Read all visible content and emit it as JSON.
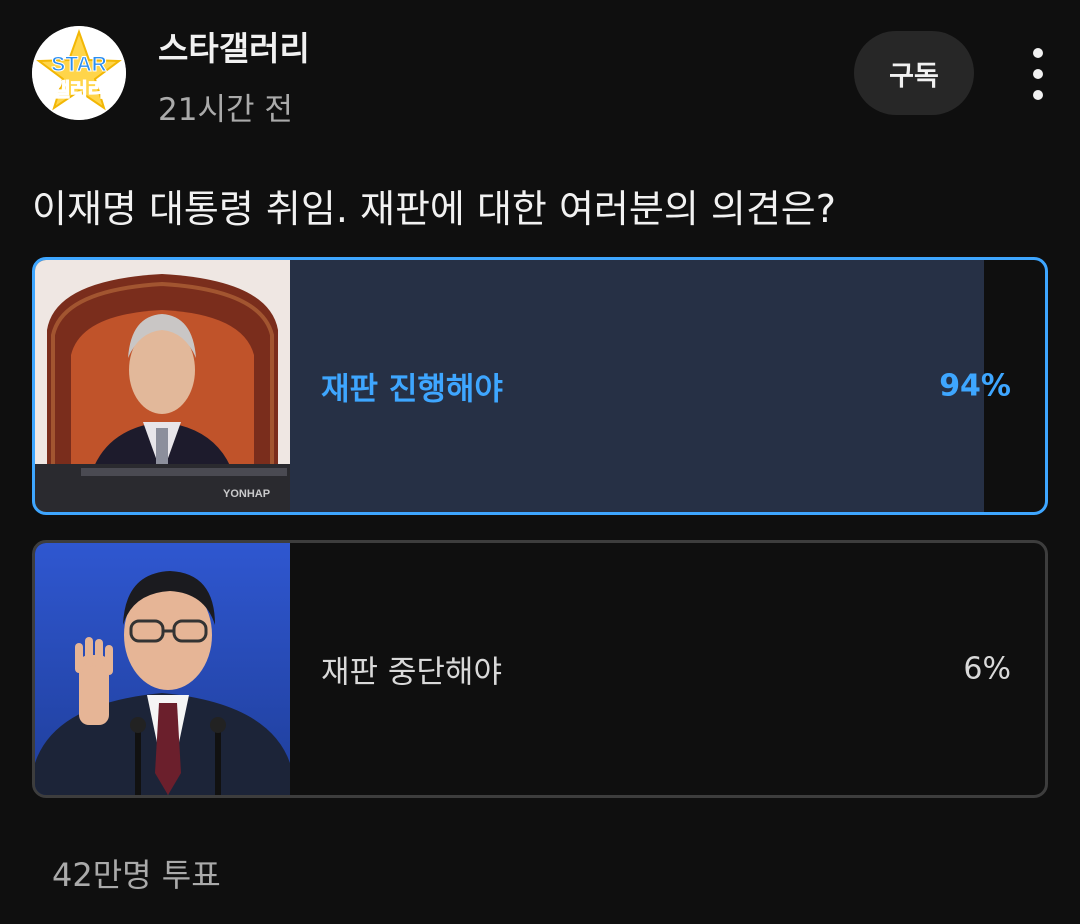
{
  "channel": {
    "name": "스타갤러리",
    "time": "21시간 전",
    "avatar_text_top": "STAR",
    "avatar_text_bottom": "갤러리"
  },
  "actions": {
    "subscribe_label": "구독",
    "more_icon": "more-vert-icon"
  },
  "poll": {
    "question": "이재명 대통령 취임. 재판에 대한 여러분의 의견은?",
    "options": [
      {
        "label": "재판 진행해야",
        "percent_text": "94%",
        "percent": 94,
        "selected": true,
        "image_watermark": "YONHAP"
      },
      {
        "label": "재판 중단해야",
        "percent_text": "6%",
        "percent": 6,
        "selected": false
      }
    ],
    "vote_count": "42만명 투표"
  },
  "colors": {
    "background": "#0f0f0f",
    "accent": "#3ea6ff",
    "selected_fill": "#263045",
    "unselected_fill": "#3a3a3a",
    "secondary_text": "#aaaaaa"
  }
}
